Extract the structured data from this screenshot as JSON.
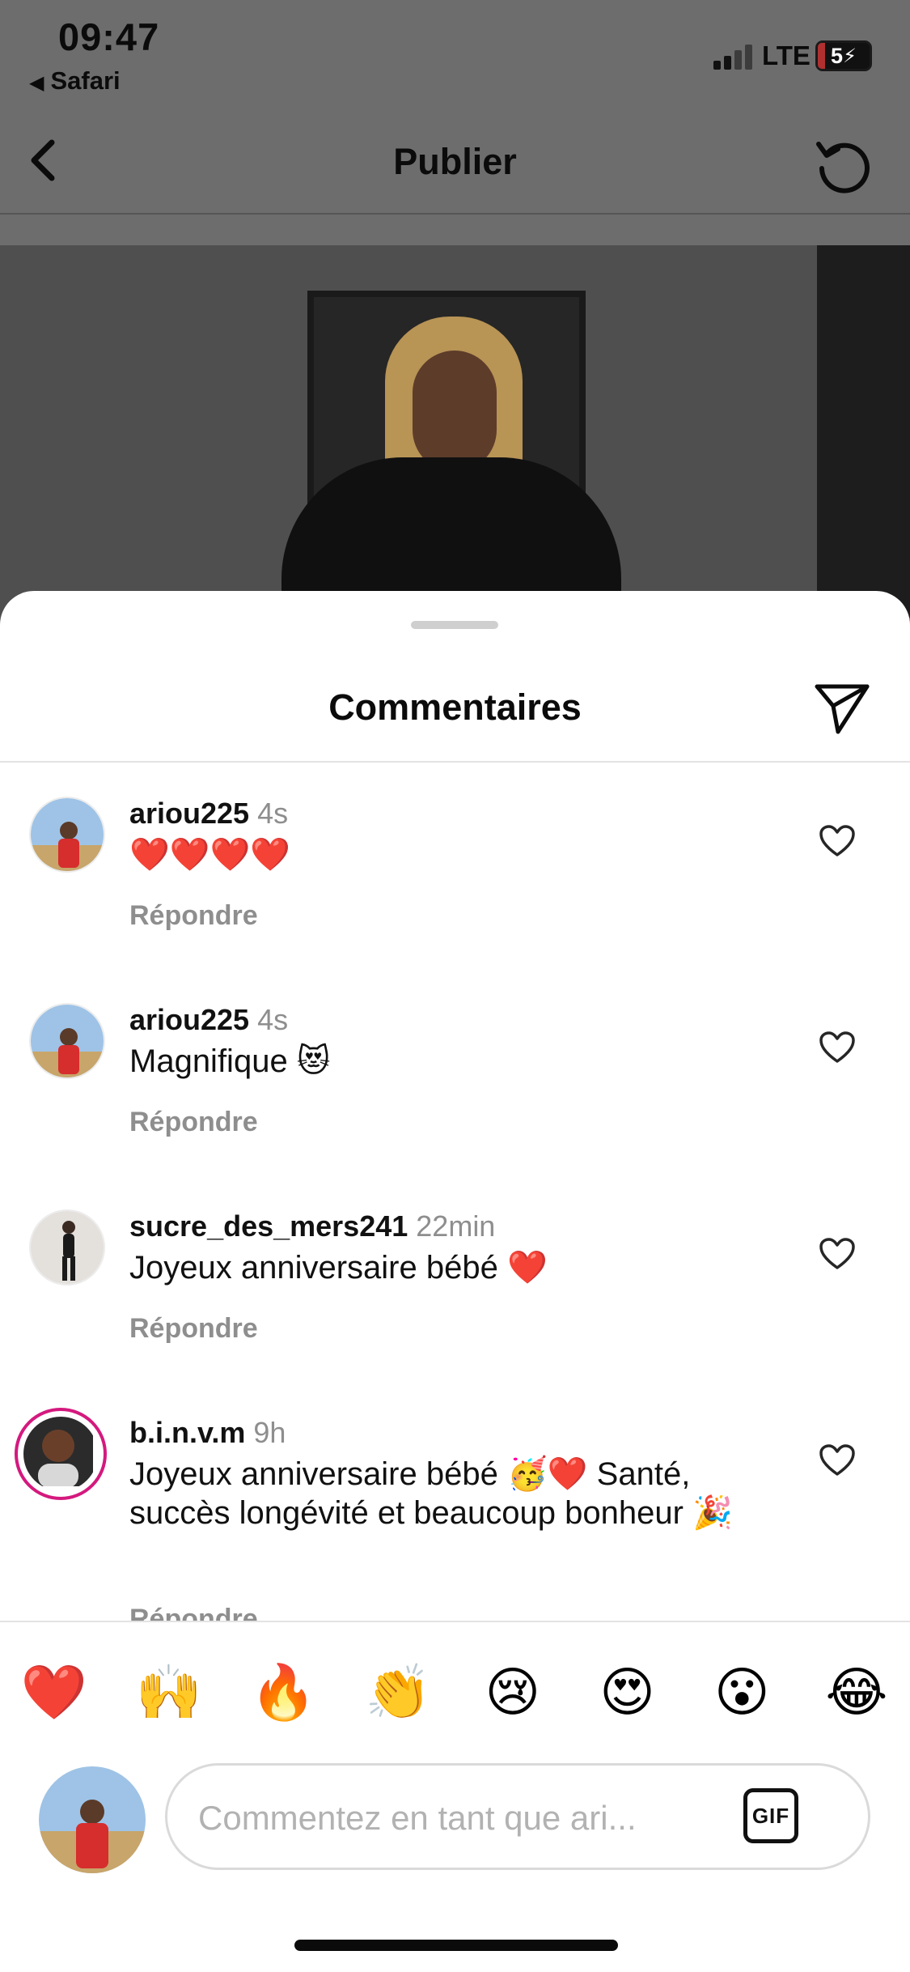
{
  "status_bar": {
    "time": "09:47",
    "back_app": "Safari",
    "network": "LTE",
    "battery": "5"
  },
  "nav": {
    "title": "Publier"
  },
  "sheet": {
    "title": "Commentaires"
  },
  "comments": [
    {
      "username": "ariou225",
      "time": "4s",
      "text": "❤️❤️❤️❤️",
      "reply_label": "Répondre"
    },
    {
      "username": "ariou225",
      "time": "4s",
      "text": "Magnifique 😻",
      "reply_label": "Répondre"
    },
    {
      "username": "sucre_des_mers241",
      "time": "22min",
      "text": "Joyeux anniversaire bébé ❤️",
      "reply_label": "Répondre"
    },
    {
      "username": "b.i.n.v.m",
      "time": "9h",
      "text": "Joyeux anniversaire bébé 🥳❤️ Santé, succès longévité et beaucoup bonheur 🎉",
      "reply_label": "Répondre"
    }
  ],
  "reactions": [
    "❤️",
    "🙌",
    "🔥",
    "👏",
    "😢",
    "😍",
    "😮",
    "😂"
  ],
  "composer": {
    "placeholder": "Commentez en tant que ari...",
    "gif_label": "GIF"
  },
  "colors": {
    "text_primary": "#0b0b0b",
    "text_secondary": "#8e8e8e",
    "story_ring": "#d4197e",
    "divider": "#e3e3e3"
  }
}
